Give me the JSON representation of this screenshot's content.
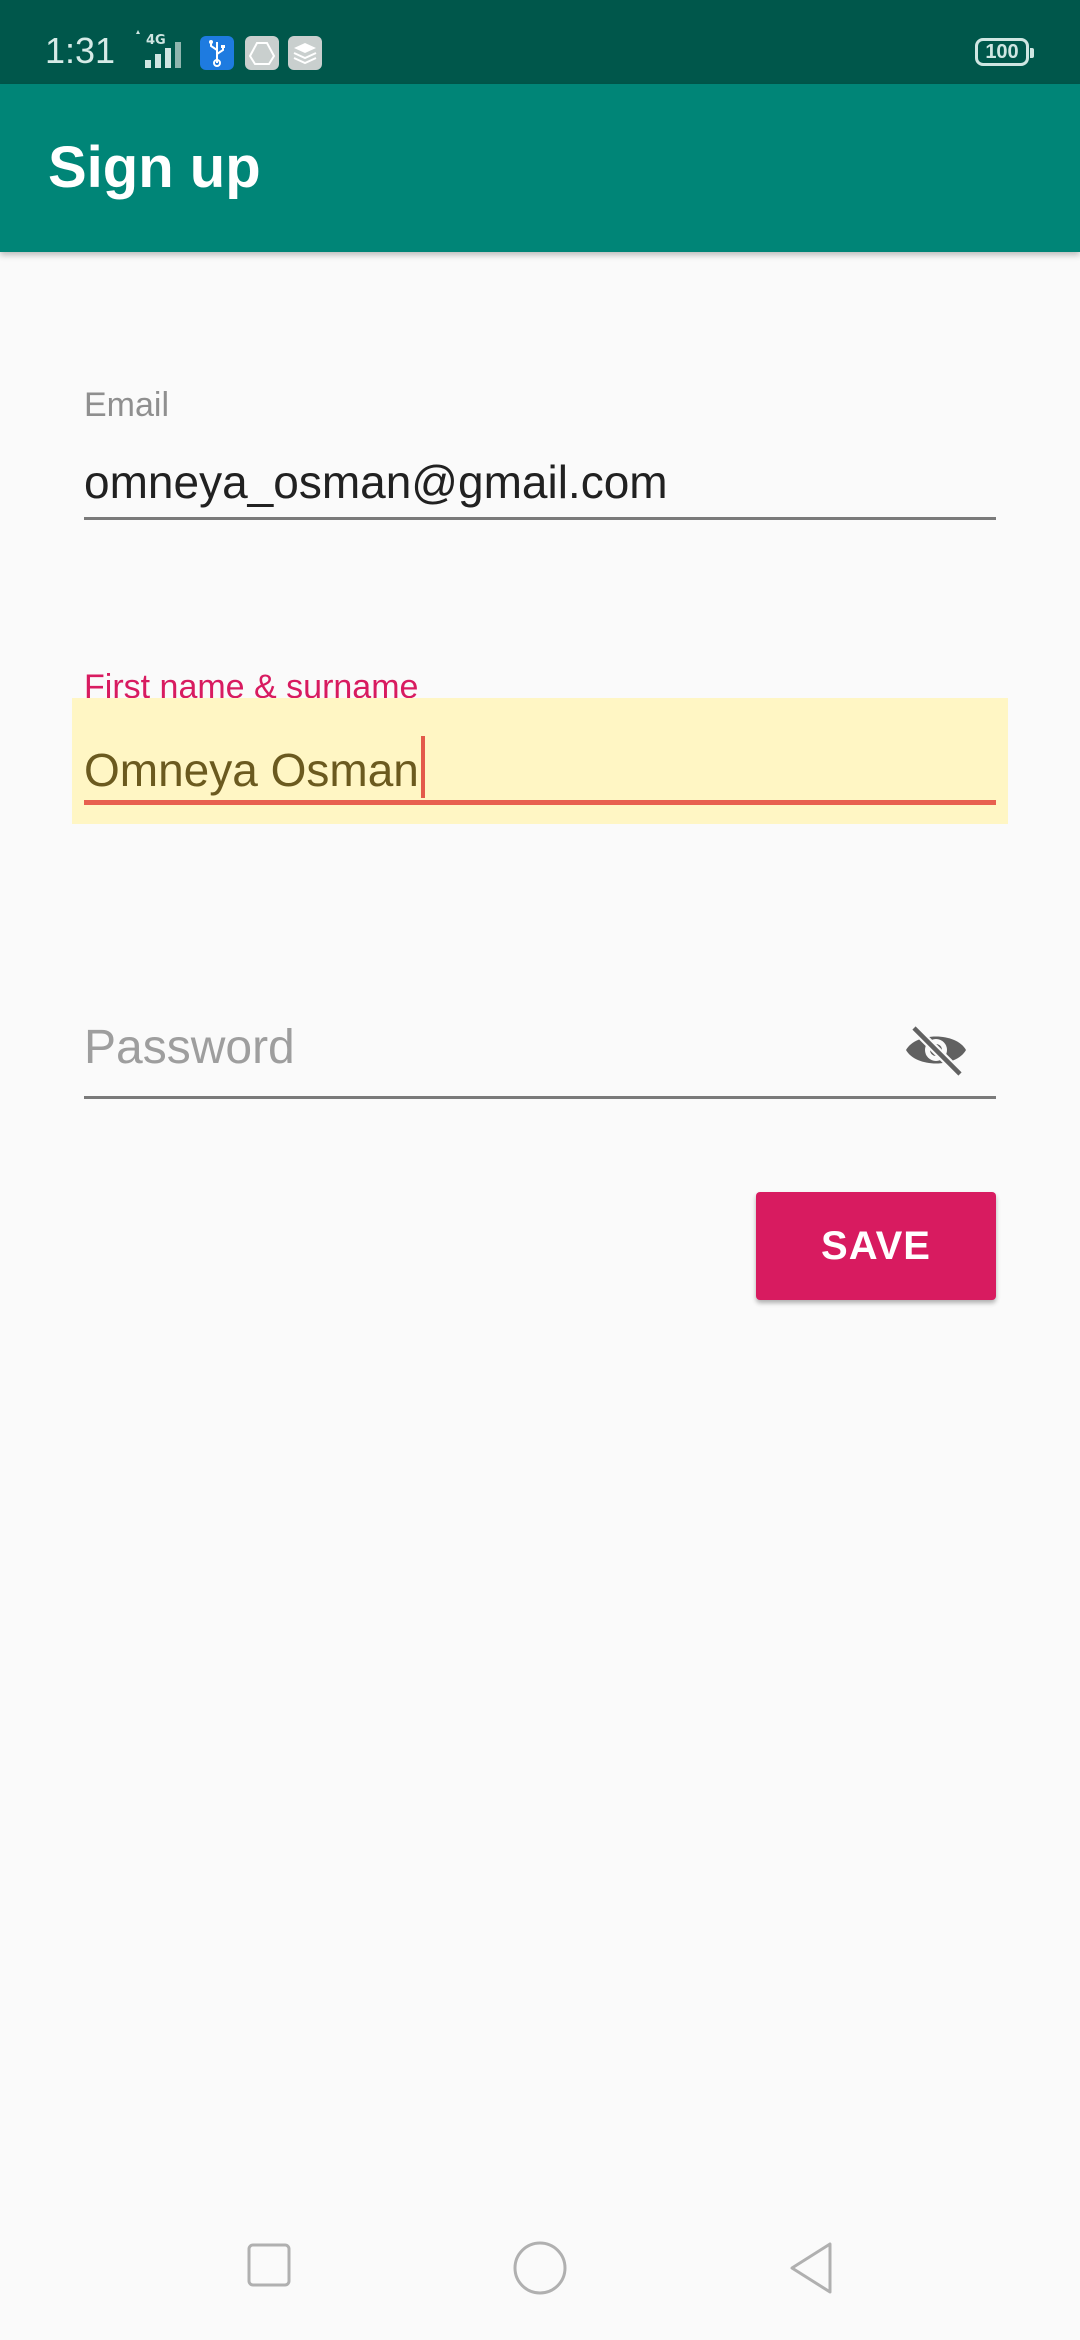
{
  "status_bar": {
    "time": "1:31",
    "network": "4G",
    "battery": "100"
  },
  "app_bar": {
    "title": "Sign up"
  },
  "form": {
    "email": {
      "label": "Email",
      "value": "omneya_osman@gmail.com"
    },
    "name": {
      "label": "First name & surname",
      "value": "Omneya Osman"
    },
    "password": {
      "placeholder": "Password"
    },
    "save_label": "SAVE"
  },
  "colors": {
    "status_bar": "#00574b",
    "app_bar": "#008577",
    "accent": "#d81b60",
    "focused_underline": "#e8604f",
    "field_highlight": "#fff6c4"
  },
  "icons": {
    "password_toggle": "eye-off-icon",
    "nav_recent": "square-icon",
    "nav_home": "circle-icon",
    "nav_back": "triangle-back-icon"
  }
}
